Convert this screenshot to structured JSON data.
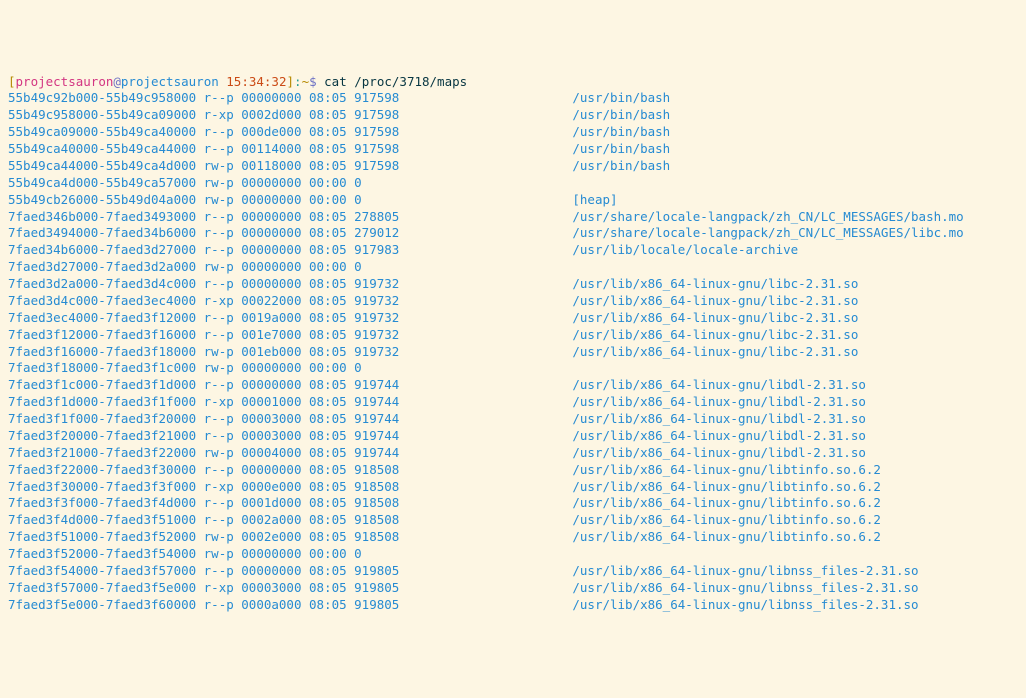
{
  "prompt": {
    "open_bracket": "[",
    "user": "projectsauron",
    "at": "@",
    "host": "projectsauron",
    "time": "15:34:32",
    "close_bracket": "]",
    "sep": ":",
    "cwd": "~",
    "dollar": "$"
  },
  "command": "cat /proc/3718/maps",
  "rows": [
    {
      "range": "55b49c92b000-55b49c958000",
      "perm": "r--p",
      "off": "00000000",
      "dev": "08:05",
      "inode": "917598",
      "path": "/usr/bin/bash"
    },
    {
      "range": "55b49c958000-55b49ca09000",
      "perm": "r-xp",
      "off": "0002d000",
      "dev": "08:05",
      "inode": "917598",
      "path": "/usr/bin/bash"
    },
    {
      "range": "55b49ca09000-55b49ca40000",
      "perm": "r--p",
      "off": "000de000",
      "dev": "08:05",
      "inode": "917598",
      "path": "/usr/bin/bash"
    },
    {
      "range": "55b49ca40000-55b49ca44000",
      "perm": "r--p",
      "off": "00114000",
      "dev": "08:05",
      "inode": "917598",
      "path": "/usr/bin/bash"
    },
    {
      "range": "55b49ca44000-55b49ca4d000",
      "perm": "rw-p",
      "off": "00118000",
      "dev": "08:05",
      "inode": "917598",
      "path": "/usr/bin/bash"
    },
    {
      "range": "55b49ca4d000-55b49ca57000",
      "perm": "rw-p",
      "off": "00000000",
      "dev": "00:00",
      "inode": "0",
      "path": ""
    },
    {
      "range": "55b49cb26000-55b49d04a000",
      "perm": "rw-p",
      "off": "00000000",
      "dev": "00:00",
      "inode": "0",
      "path": "[heap]"
    },
    {
      "range": "7faed346b000-7faed3493000",
      "perm": "r--p",
      "off": "00000000",
      "dev": "08:05",
      "inode": "278805",
      "path": "/usr/share/locale-langpack/zh_CN/LC_MESSAGES/bash.mo"
    },
    {
      "range": "7faed3494000-7faed34b6000",
      "perm": "r--p",
      "off": "00000000",
      "dev": "08:05",
      "inode": "279012",
      "path": "/usr/share/locale-langpack/zh_CN/LC_MESSAGES/libc.mo"
    },
    {
      "range": "7faed34b6000-7faed3d27000",
      "perm": "r--p",
      "off": "00000000",
      "dev": "08:05",
      "inode": "917983",
      "path": "/usr/lib/locale/locale-archive"
    },
    {
      "range": "7faed3d27000-7faed3d2a000",
      "perm": "rw-p",
      "off": "00000000",
      "dev": "00:00",
      "inode": "0",
      "path": ""
    },
    {
      "range": "7faed3d2a000-7faed3d4c000",
      "perm": "r--p",
      "off": "00000000",
      "dev": "08:05",
      "inode": "919732",
      "path": "/usr/lib/x86_64-linux-gnu/libc-2.31.so"
    },
    {
      "range": "7faed3d4c000-7faed3ec4000",
      "perm": "r-xp",
      "off": "00022000",
      "dev": "08:05",
      "inode": "919732",
      "path": "/usr/lib/x86_64-linux-gnu/libc-2.31.so"
    },
    {
      "range": "7faed3ec4000-7faed3f12000",
      "perm": "r--p",
      "off": "0019a000",
      "dev": "08:05",
      "inode": "919732",
      "path": "/usr/lib/x86_64-linux-gnu/libc-2.31.so"
    },
    {
      "range": "7faed3f12000-7faed3f16000",
      "perm": "r--p",
      "off": "001e7000",
      "dev": "08:05",
      "inode": "919732",
      "path": "/usr/lib/x86_64-linux-gnu/libc-2.31.so"
    },
    {
      "range": "7faed3f16000-7faed3f18000",
      "perm": "rw-p",
      "off": "001eb000",
      "dev": "08:05",
      "inode": "919732",
      "path": "/usr/lib/x86_64-linux-gnu/libc-2.31.so"
    },
    {
      "range": "7faed3f18000-7faed3f1c000",
      "perm": "rw-p",
      "off": "00000000",
      "dev": "00:00",
      "inode": "0",
      "path": ""
    },
    {
      "range": "7faed3f1c000-7faed3f1d000",
      "perm": "r--p",
      "off": "00000000",
      "dev": "08:05",
      "inode": "919744",
      "path": "/usr/lib/x86_64-linux-gnu/libdl-2.31.so"
    },
    {
      "range": "7faed3f1d000-7faed3f1f000",
      "perm": "r-xp",
      "off": "00001000",
      "dev": "08:05",
      "inode": "919744",
      "path": "/usr/lib/x86_64-linux-gnu/libdl-2.31.so"
    },
    {
      "range": "7faed3f1f000-7faed3f20000",
      "perm": "r--p",
      "off": "00003000",
      "dev": "08:05",
      "inode": "919744",
      "path": "/usr/lib/x86_64-linux-gnu/libdl-2.31.so"
    },
    {
      "range": "7faed3f20000-7faed3f21000",
      "perm": "r--p",
      "off": "00003000",
      "dev": "08:05",
      "inode": "919744",
      "path": "/usr/lib/x86_64-linux-gnu/libdl-2.31.so"
    },
    {
      "range": "7faed3f21000-7faed3f22000",
      "perm": "rw-p",
      "off": "00004000",
      "dev": "08:05",
      "inode": "919744",
      "path": "/usr/lib/x86_64-linux-gnu/libdl-2.31.so"
    },
    {
      "range": "7faed3f22000-7faed3f30000",
      "perm": "r--p",
      "off": "00000000",
      "dev": "08:05",
      "inode": "918508",
      "path": "/usr/lib/x86_64-linux-gnu/libtinfo.so.6.2"
    },
    {
      "range": "7faed3f30000-7faed3f3f000",
      "perm": "r-xp",
      "off": "0000e000",
      "dev": "08:05",
      "inode": "918508",
      "path": "/usr/lib/x86_64-linux-gnu/libtinfo.so.6.2"
    },
    {
      "range": "7faed3f3f000-7faed3f4d000",
      "perm": "r--p",
      "off": "0001d000",
      "dev": "08:05",
      "inode": "918508",
      "path": "/usr/lib/x86_64-linux-gnu/libtinfo.so.6.2"
    },
    {
      "range": "7faed3f4d000-7faed3f51000",
      "perm": "r--p",
      "off": "0002a000",
      "dev": "08:05",
      "inode": "918508",
      "path": "/usr/lib/x86_64-linux-gnu/libtinfo.so.6.2"
    },
    {
      "range": "7faed3f51000-7faed3f52000",
      "perm": "rw-p",
      "off": "0002e000",
      "dev": "08:05",
      "inode": "918508",
      "path": "/usr/lib/x86_64-linux-gnu/libtinfo.so.6.2"
    },
    {
      "range": "7faed3f52000-7faed3f54000",
      "perm": "rw-p",
      "off": "00000000",
      "dev": "00:00",
      "inode": "0",
      "path": ""
    },
    {
      "range": "7faed3f54000-7faed3f57000",
      "perm": "r--p",
      "off": "00000000",
      "dev": "08:05",
      "inode": "919805",
      "path": "/usr/lib/x86_64-linux-gnu/libnss_files-2.31.so"
    },
    {
      "range": "7faed3f57000-7faed3f5e000",
      "perm": "r-xp",
      "off": "00003000",
      "dev": "08:05",
      "inode": "919805",
      "path": "/usr/lib/x86_64-linux-gnu/libnss_files-2.31.so"
    },
    {
      "range": "7faed3f5e000-7faed3f60000",
      "perm": "r--p",
      "off": "0000a000",
      "dev": "08:05",
      "inode": "919805",
      "path": "/usr/lib/x86_64-linux-gnu/libnss_files-2.31.so"
    }
  ]
}
